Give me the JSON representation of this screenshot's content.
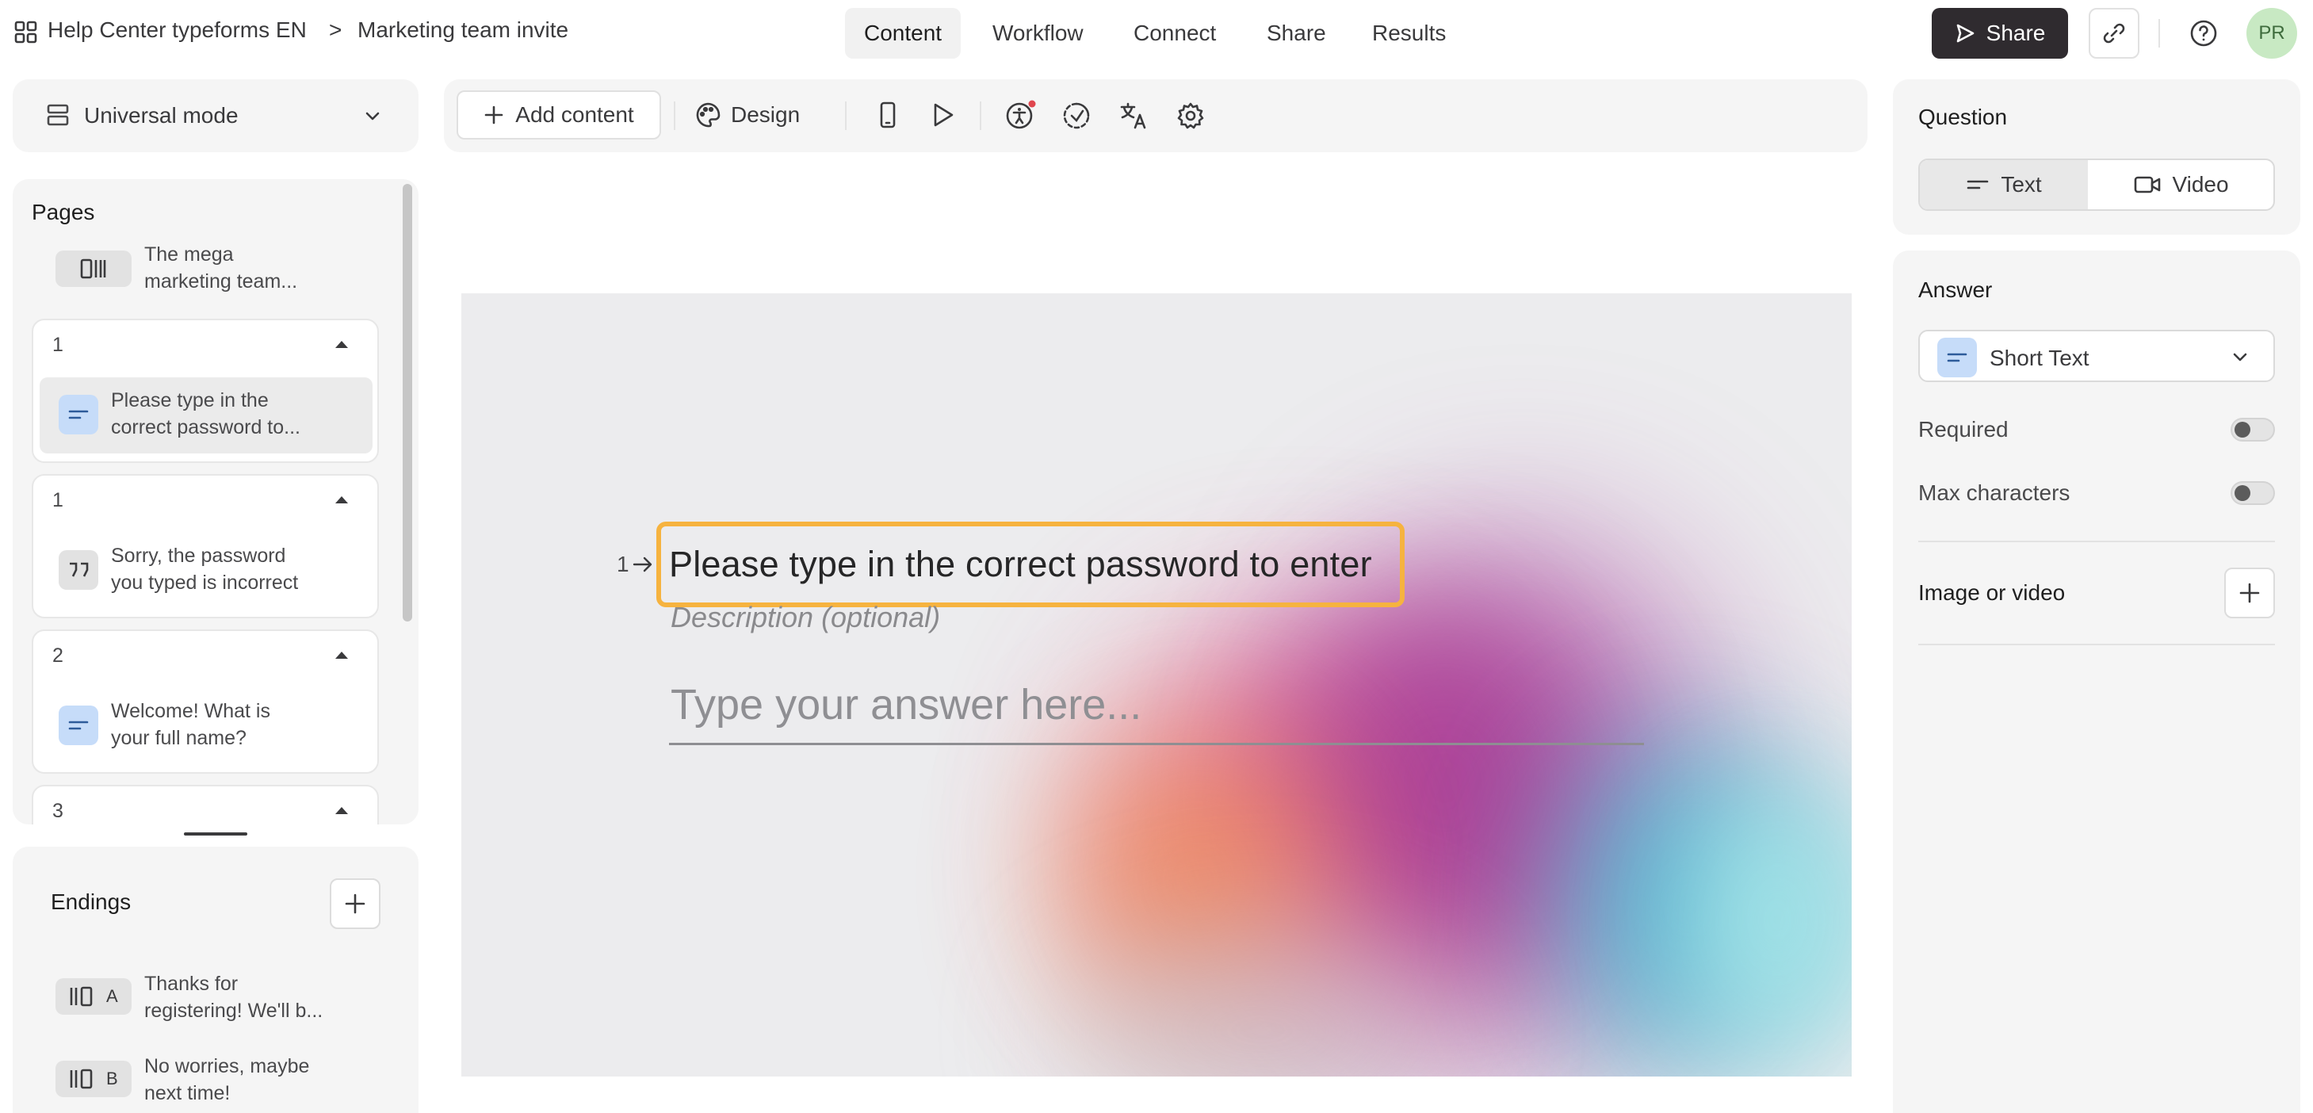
{
  "topbar": {
    "workspace": "Help Center typeforms EN",
    "separator": ">",
    "form_name": "Marketing team invite",
    "tabs": [
      {
        "label": "Content",
        "active": true
      },
      {
        "label": "Workflow",
        "active": false
      },
      {
        "label": "Connect",
        "active": false
      },
      {
        "label": "Share",
        "active": false
      },
      {
        "label": "Results",
        "active": false
      }
    ],
    "share_label": "Share",
    "avatar_initials": "PR"
  },
  "mode_selector": {
    "label": "Universal mode"
  },
  "toolbar": {
    "add_content": "Add content",
    "design": "Design",
    "icons": [
      "phone-preview-icon",
      "play-icon",
      "accessibility-icon",
      "logic-icon",
      "translate-icon",
      "settings-icon"
    ]
  },
  "pages": {
    "title": "Pages",
    "welcome": {
      "text_line1": "The mega",
      "text_line2": "marketing team..."
    },
    "items": [
      {
        "number": "1",
        "line1": "Please type in the",
        "line2": "correct password to...",
        "type": "short-text",
        "selected": true
      },
      {
        "number": "1",
        "line1": "Sorry, the password",
        "line2": "you typed is incorrect",
        "type": "statement",
        "selected": false
      },
      {
        "number": "2",
        "line1": "Welcome! What is",
        "line2": "your full name?",
        "type": "short-text",
        "selected": false
      },
      {
        "number": "3"
      }
    ]
  },
  "endings": {
    "title": "Endings",
    "items": [
      {
        "letter": "A",
        "line1": "Thanks for",
        "line2": "registering! We'll b..."
      },
      {
        "letter": "B",
        "line1": "No worries, maybe",
        "line2": "next time!"
      }
    ]
  },
  "canvas": {
    "question_number": "1",
    "question_text": "Please type in the correct password to enter",
    "description_placeholder": "Description (optional)",
    "answer_placeholder": "Type your answer here..."
  },
  "right_panel": {
    "question_heading": "Question",
    "text_tab": "Text",
    "video_tab": "Video",
    "answer_heading": "Answer",
    "answer_type": "Short Text",
    "required_label": "Required",
    "max_chars_label": "Max characters",
    "image_video_label": "Image or video",
    "required_on": false,
    "max_chars_on": false
  },
  "colors": {
    "highlight": "#f6b33f",
    "share_button": "#2f2b2f",
    "chip_blue": "#c6dcf9",
    "avatar_bg": "#c8e9c3"
  }
}
